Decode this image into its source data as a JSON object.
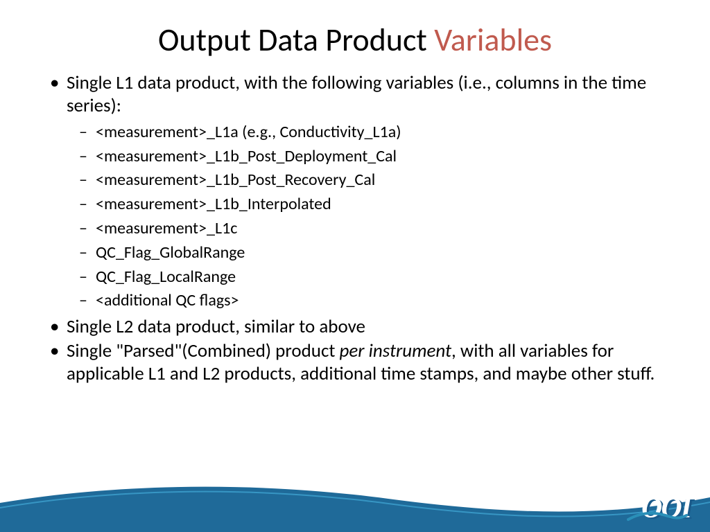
{
  "title": {
    "main": "Output Data Product ",
    "accent": "Variables"
  },
  "bullets": {
    "b1": "Single L1 data product, with the following variables (i.e., columns in the time series):",
    "sub": {
      "s1": "<measurement>_L1a (e.g., Conductivity_L1a)",
      "s2": "<measurement>_L1b_Post_Deployment_Cal",
      "s3": "<measurement>_L1b_Post_Recovery_Cal",
      "s4": "<measurement>_L1b_Interpolated",
      "s5": "<measurement>_L1c",
      "s6": "QC_Flag_GlobalRange",
      "s7": "QC_Flag_LocalRange",
      "s8": "<additional QC flags>"
    },
    "b2": "Single L2 data product, similar to above",
    "b3_pre": "Single \"Parsed\"(Combined) product ",
    "b3_em": "per instrument",
    "b3_post": ", with all variables for applicable L1 and L2 products, additional time stamps, and maybe other stuff."
  },
  "logo_text": "OOI"
}
